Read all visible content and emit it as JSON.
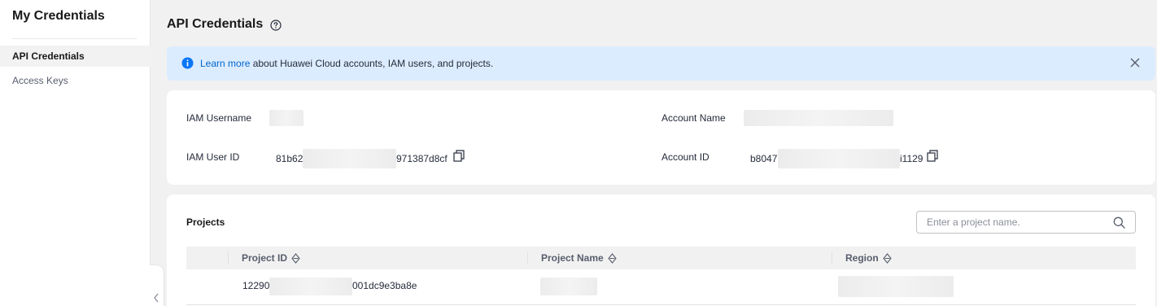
{
  "sidebar": {
    "title": "My Credentials",
    "items": [
      {
        "label": "API Credentials",
        "active": true
      },
      {
        "label": "Access Keys",
        "active": false
      }
    ]
  },
  "header": {
    "title": "API Credentials"
  },
  "banner": {
    "link_text": "Learn more",
    "text": " about Huawei Cloud accounts, IAM users, and projects."
  },
  "info": {
    "iam_username_label": "IAM Username",
    "iam_user_id_label": "IAM User ID",
    "iam_user_id_prefix": "81b62",
    "iam_user_id_suffix": "971387d8cf",
    "account_name_label": "Account Name",
    "account_id_label": "Account ID",
    "account_id_prefix": "b8047",
    "account_id_suffix": "i1129"
  },
  "projects": {
    "title": "Projects",
    "search_placeholder": "Enter a project name.",
    "columns": [
      "Project ID",
      "Project Name",
      "Region"
    ],
    "rows": [
      {
        "project_id_prefix": "12290",
        "project_id_suffix": "001dc9e3ba8e"
      }
    ]
  },
  "colors": {
    "link": "#0066cc",
    "banner_bg": "#dcecff",
    "info_icon": "#0a76f6"
  }
}
